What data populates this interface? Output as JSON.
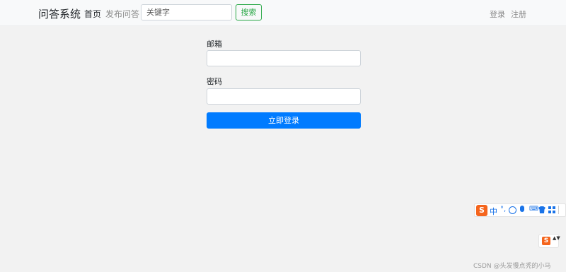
{
  "navbar": {
    "brand": "问答系统",
    "nav_home": "首页",
    "nav_post_question": "发布问答",
    "search_placeholder": "关键字",
    "search_button": "搜索",
    "login": "登录",
    "register": "注册"
  },
  "login_form": {
    "email_label": "邮箱",
    "email_value": "",
    "password_label": "密码",
    "password_value": "",
    "submit_label": "立即登录"
  },
  "ime_toolbar": {
    "logo": "S",
    "mode": "中",
    "punctuation": "°,",
    "keyboard": "⌨",
    "mini_logo": "S",
    "mini_arrows": "▲▼"
  },
  "watermark": "CSDN @头发慢点秃的小马",
  "colors": {
    "primary": "#007bff",
    "success": "#28a745",
    "ime_orange": "#f5651d",
    "ime_blue": "#1a73e8",
    "page_bg": "#f2f2f2"
  },
  "icons": [
    "emoji-icon",
    "microphone-icon",
    "keyboard-icon",
    "skin-icon",
    "toolbox-icon"
  ]
}
